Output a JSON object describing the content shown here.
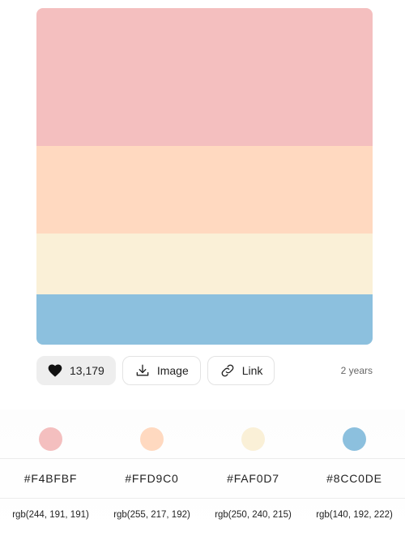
{
  "palette": {
    "colors": [
      {
        "hex": "#F4BFBF",
        "css": "#F4BFBF",
        "rgb": "rgb(244, 191, 191)"
      },
      {
        "hex": "#FFD9C0",
        "css": "#FFD9C0",
        "rgb": "rgb(255, 217, 192)"
      },
      {
        "hex": "#FAF0D7",
        "css": "#FAF0D7",
        "rgb": "rgb(250, 240, 215)"
      },
      {
        "hex": "#8CC0DE",
        "css": "#8CC0DE",
        "rgb": "rgb(140, 192, 222)"
      }
    ]
  },
  "actions": {
    "like_count": "13,179",
    "like_icon": "heart-icon",
    "image_label": "Image",
    "image_icon": "download-icon",
    "link_label": "Link",
    "link_icon": "link-icon"
  },
  "meta": {
    "age": "2 years"
  }
}
